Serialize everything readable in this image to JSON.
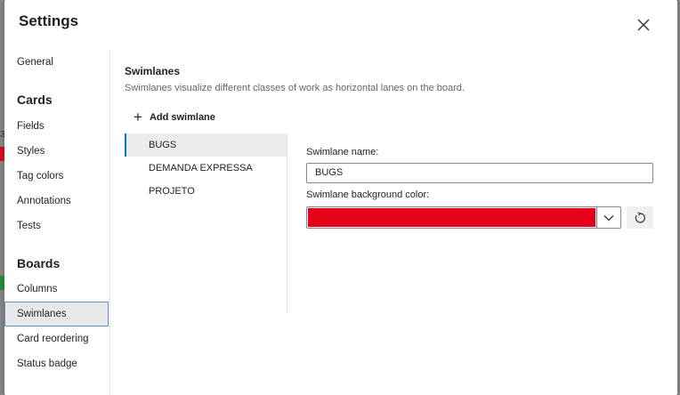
{
  "background": {
    "row_number": "3"
  },
  "dialog": {
    "title": "Settings"
  },
  "nav": {
    "general": "General",
    "cards_header": "Cards",
    "fields": "Fields",
    "styles": "Styles",
    "tag_colors": "Tag colors",
    "annotations": "Annotations",
    "tests": "Tests",
    "boards_header": "Boards",
    "columns": "Columns",
    "swimlanes": "Swimlanes",
    "card_reordering": "Card reordering",
    "status_badge": "Status badge",
    "selected": "Swimlanes"
  },
  "content": {
    "title": "Swimlanes",
    "description": "Swimlanes visualize different classes of work as horizontal lanes on the board.",
    "add_label": "Add swimlane",
    "lanes": [
      "BUGS",
      "DEMANDA EXPRESSA",
      "PROJETO"
    ],
    "selected_lane": "BUGS",
    "name_label": "Swimlane name:",
    "name_value": "BUGS",
    "color_label": "Swimlane background color:",
    "color_value": "#e6001a"
  },
  "icons": {
    "close": "close-icon",
    "add": "plus-icon",
    "dropdown": "chevron-down-icon",
    "reset": "reset-icon"
  }
}
